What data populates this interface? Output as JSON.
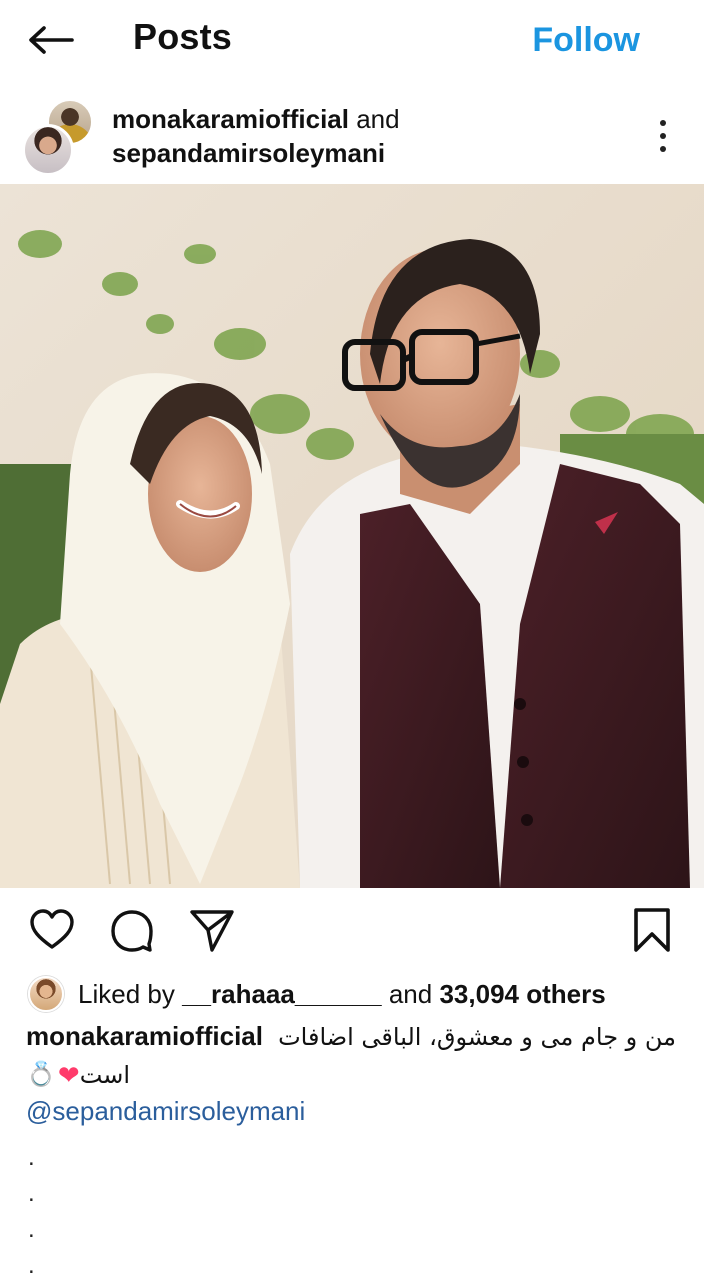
{
  "topbar": {
    "back_icon": "arrow-left-icon",
    "title": "Posts",
    "follow_label": "Follow",
    "follow_color": "#1b95e0"
  },
  "post": {
    "user1": "monakaramiofficial",
    "and_word": "and",
    "user2": "sepandamirsoleymani",
    "more_icon": "more-vertical-icon"
  },
  "actions": {
    "like_icon": "heart-outline-icon",
    "comment_icon": "comment-bubble-icon",
    "share_icon": "paper-plane-icon",
    "save_icon": "bookmark-outline-icon"
  },
  "likes": {
    "prefix": "Liked by",
    "liker": "__rahaaa______",
    "middle": "and",
    "count_text": "33,094 others"
  },
  "caption": {
    "username": "monakaramiofficial",
    "line1": "من و جام می و معشوق، الباقی اضافات",
    "line2_text": "است",
    "heart": "❤",
    "ring": "💍",
    "mention": "@sepandamirsoleymani",
    "dots": [
      ".",
      ".",
      ".",
      "."
    ]
  }
}
